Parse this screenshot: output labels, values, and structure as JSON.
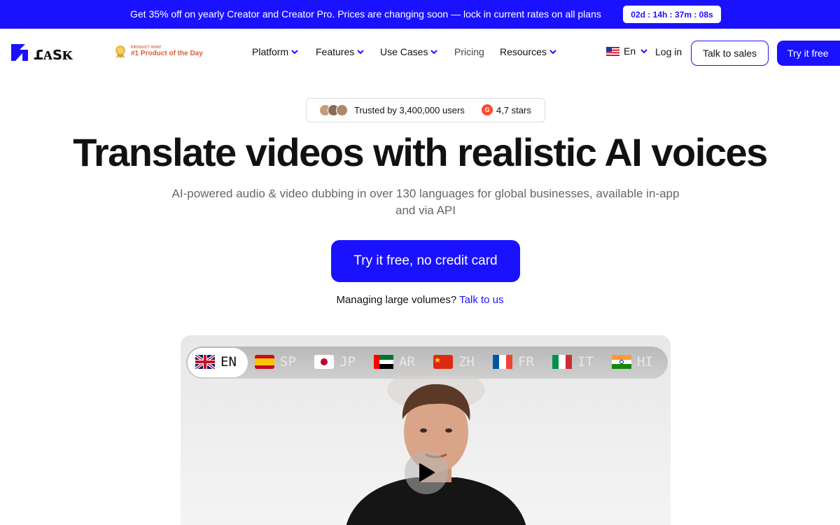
{
  "promo": {
    "text": "Get 35% off on yearly Creator and Creator Pro. Prices are changing soon — lock in current rates on all plans",
    "timer": "02d : 14h : 37m : 08s"
  },
  "nav": {
    "brand": "RASK",
    "product_hunt_small": "PRODUCT HUNT",
    "product_hunt_big": "#1 Product of the Day",
    "menu": [
      {
        "label": "Platform"
      },
      {
        "label": "Features"
      },
      {
        "label": "Use Cases"
      },
      {
        "label": "Pricing"
      },
      {
        "label": "Resources"
      }
    ],
    "language": "En",
    "login": "Log in",
    "talk_sales": "Talk to sales",
    "try_free": "Try it free"
  },
  "hero": {
    "trusted": "Trusted by 3,400,000 users",
    "g2_letter": "G",
    "stars": "4,7 stars",
    "title": "Translate videos with realistic AI voices",
    "subtitle": "AI-powered audio & video dubbing in over 130 languages for global businesses, available in-app and via API",
    "cta": "Try it free, no credit card",
    "manage_text": "Managing large volumes?",
    "manage_link": "Talk to us"
  },
  "video": {
    "languages": [
      "EN",
      "SP",
      "JP",
      "AR",
      "ZH",
      "FR",
      "IT",
      "HI"
    ],
    "active_language": "EN"
  },
  "colors": {
    "brand": "#1a12ff",
    "g2": "#ff492c",
    "product_hunt": "#d6623c"
  }
}
